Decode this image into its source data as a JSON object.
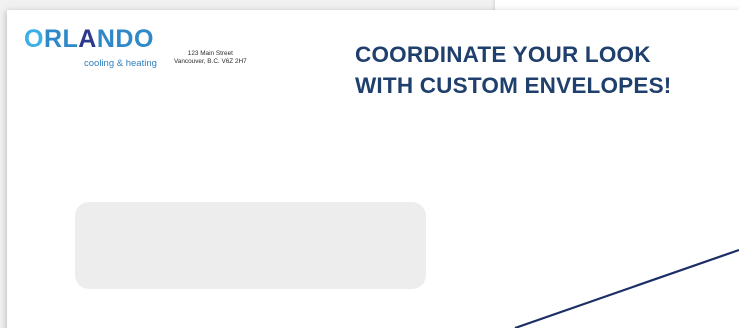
{
  "logo": {
    "letters": [
      "O",
      "R",
      "L",
      "A",
      "N",
      "D",
      "O"
    ],
    "tagline": "cooling & heating",
    "colors": {
      "light": "#3bb0e6",
      "mid": "#2f89c9",
      "dark": "#2c3a8e"
    }
  },
  "address": {
    "line1": "123 Main Street",
    "line2": "Vancouver, B.C. V6Z 2H7"
  },
  "headline": {
    "line1": "COORDINATE YOUR LOOK",
    "line2": "WITH CUSTOM ENVELOPES!",
    "color": "#1f3f6c"
  },
  "envelope": {
    "background": "#ffffff",
    "window_color": "#ededee",
    "flap_line_color": "#1b2f66"
  }
}
